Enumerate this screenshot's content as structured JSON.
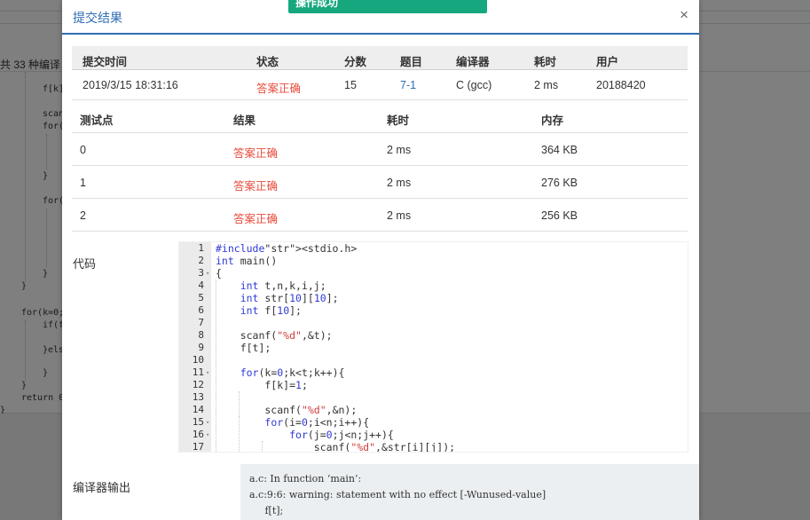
{
  "toast": {
    "text": "操作成功"
  },
  "modal": {
    "title": "提交结果",
    "close_symbol": "×"
  },
  "background": {
    "count_text": "共 33 种编译",
    "code_lines": [
      "f[k]",
      "scan",
      "for(",
      "}",
      "for(",
      "}",
      "}",
      "for(k=0;",
      "if(f",
      "}els",
      "}",
      "}",
      "return 0",
      "}"
    ]
  },
  "summary": {
    "headers": [
      "提交时间",
      "状态",
      "分数",
      "题目",
      "编译器",
      "耗时",
      "用户"
    ],
    "row": {
      "time": "2019/3/15 18:31:16",
      "status": "答案正确",
      "score": "15",
      "problem": "7-1",
      "compiler": "C (gcc)",
      "elapsed": "2 ms",
      "user": "20188420"
    }
  },
  "testcases": {
    "headers": [
      "测试点",
      "结果",
      "耗时",
      "内存"
    ],
    "rows": [
      {
        "id": "0",
        "result": "答案正确",
        "time": "2 ms",
        "memory": "364 KB"
      },
      {
        "id": "1",
        "result": "答案正确",
        "time": "2 ms",
        "memory": "276 KB"
      },
      {
        "id": "2",
        "result": "答案正确",
        "time": "2 ms",
        "memory": "256 KB"
      }
    ]
  },
  "code": {
    "label": "代码",
    "line_numbers": [
      "1",
      "2",
      "3",
      "4",
      "5",
      "6",
      "7",
      "8",
      "9",
      "10",
      "11",
      "12",
      "13",
      "14",
      "15",
      "16",
      "17"
    ],
    "lines": [
      "#include<stdio.h>",
      "int main()",
      "{",
      "    int t,n,k,i,j;",
      "    int str[10][10];",
      "    int f[10];",
      "",
      "    scanf(\"%d\",&t);",
      "    f[t];",
      "",
      "    for(k=0;k<t;k++){",
      "        f[k]=1;",
      "",
      "        scanf(\"%d\",&n);",
      "        for(i=0;i<n;i++){",
      "            for(j=0;j<n;j++){",
      "                scanf(\"%d\",&str[i][j]);"
    ]
  },
  "compiler_output": {
    "label": "编译器输出",
    "lines": [
      "a.c: In function ‘main’:",
      "a.c:9:6: warning: statement with no effect [-Wunused-value]",
      "     f[t];"
    ]
  },
  "colors": {
    "accent": "#2e6db4",
    "success": "#e74c3c",
    "toast": "#16a77f"
  }
}
